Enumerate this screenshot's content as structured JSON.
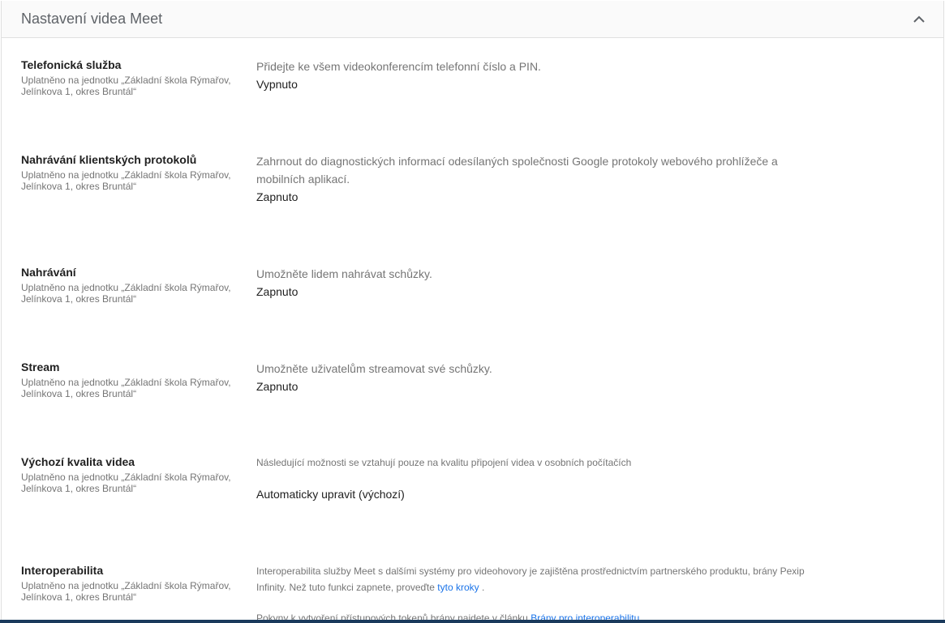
{
  "section": {
    "title": "Nastavení videa Meet",
    "collapse_icon": "chevron-up-icon"
  },
  "scope_text": "Uplatněno na jednotku „Základní škola Rýmařov, Jelínkova 1, okres Bruntál“",
  "settings": [
    {
      "name": "Telefonická služba",
      "description": "Přidejte ke všem videokonferencím telefonní číslo a PIN.",
      "value": "Vypnuto"
    },
    {
      "name": "Nahrávání klientských protokolů",
      "description": "Zahrnout do diagnostických informací odesílaných společnosti Google protokoly webového prohlížeče a mobilních aplikací.",
      "value": "Zapnuto"
    },
    {
      "name": "Nahrávání",
      "description": "Umožněte lidem nahrávat schůzky.",
      "value": "Zapnuto"
    },
    {
      "name": "Stream",
      "description": "Umožněte uživatelům streamovat své schůzky.",
      "value": "Zapnuto"
    },
    {
      "name": "Výchozí kvalita videa",
      "description": "Následující možnosti se vztahují pouze na kvalitu připojení videa v osobních počítačích",
      "value": "Automaticky upravit (výchozí)"
    },
    {
      "name": "Interoperabilita",
      "description_part1": "Interoperabilita služby Meet s dalšími systémy pro videohovory je zajištěna prostřednictvím partnerského produktu, brány Pexip Infinity. Než tuto funkci zapnete, proveďte",
      "description_link": "tyto kroky",
      "description_end": ".",
      "note_part1": "Pokyny k vytvoření přístupových tokenů brány najdete v článku",
      "note_link": "Brány pro interoperabilitu"
    }
  ]
}
